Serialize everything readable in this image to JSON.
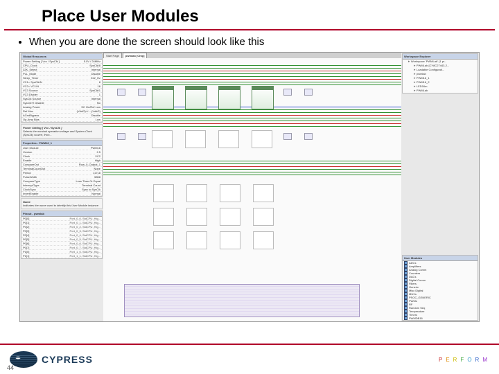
{
  "slide": {
    "title": "Place User Modules",
    "bullet": "When you are done the screen should look like this",
    "page_number": "44",
    "brand": "CYPRESS",
    "tagline": [
      "P",
      "E",
      "R",
      "F",
      "O",
      "R",
      "M"
    ]
  },
  "app": {
    "global_resources": {
      "title": "Global Resources",
      "rows": [
        [
          "Power Setting [ Vcc / SysClk ]",
          "5.0V / 24MHz"
        ],
        [
          "CPU_Clock",
          "SysClk/8"
        ],
        [
          "32K_Select",
          "Internal"
        ],
        [
          "PLL_Mode",
          "Disable"
        ],
        [
          "Sleep_Timer",
          "512_Hz"
        ],
        [
          "VC1= SysClk/N",
          "8"
        ],
        [
          "VC2= VC1/N",
          "16"
        ],
        [
          "VC3 Source",
          "SysClk/1"
        ],
        [
          "VC3 Divider",
          "1"
        ],
        [
          "SysClk Source",
          "Internal"
        ],
        [
          "SysClk*2 Disable",
          "No"
        ],
        [
          "Analog Power",
          "SC On/Ref Low"
        ],
        [
          "Ref Mux",
          "(Vdd/2)+/-...(Vdd/2)"
        ],
        [
          "AGndBypass",
          "Disable"
        ],
        [
          "Op-Amp Bias",
          "Low"
        ]
      ],
      "desc_title": "Power Setting [ Vcc / SysClk ]",
      "desc": "Selects the nominal operation voltage and System Clock (SysClk) source, from..."
    },
    "properties": {
      "title": "Properties - PWM16_1",
      "rows": [
        [
          "User Module",
          "PWM16"
        ],
        [
          "Version",
          "2.5"
        ],
        [
          "Clock",
          "VC2"
        ],
        [
          "Enable",
          "High"
        ],
        [
          "CompareOut",
          "Row_0_Output_1"
        ],
        [
          "TerminalCountOut",
          "None"
        ],
        [
          "Period",
          "11718"
        ],
        [
          "PulseWidth",
          "5858"
        ],
        [
          "CompareType",
          "Less Than Or Equal"
        ],
        [
          "InterruptType",
          "Terminal Count"
        ],
        [
          "ClockSync",
          "Sync to SysClk"
        ],
        [
          "InvertEnable",
          "Normal"
        ]
      ],
      "desc_title": "Name",
      "desc": "Indicates the name used to identify this User Module instance"
    },
    "pinout": {
      "title": "Pinout - pwmlab",
      "rows": [
        [
          "P0[0]",
          "Port_0_0, StdCPU, Hig..."
        ],
        [
          "P0[1]",
          "Port_0_1, StdCPU, Hig..."
        ],
        [
          "P0[2]",
          "Port_0_2, StdCPU, Hig..."
        ],
        [
          "P0[3]",
          "Port_0_3, StdCPU, Hig..."
        ],
        [
          "P0[4]",
          "Port_0_4, StdCPU, Hig..."
        ],
        [
          "P0[5]",
          "Port_0_5, StdCPU, Hig..."
        ],
        [
          "P0[6]",
          "Port_0_6, StdCPU, Hig..."
        ],
        [
          "P0[7]",
          "Port_0_7, StdCPU, Hig..."
        ],
        [
          "P1[0]",
          "Port_1_0, StdCPU, Hig..."
        ],
        [
          "P1[1]",
          "Port_1_1, StdCPU, Hig..."
        ]
      ]
    },
    "tabs": {
      "left": "Start Page",
      "right": "pwmlab [Chip]"
    },
    "workspace": {
      "title": "Workspace Explorer",
      "root": "Workspace 'PWMLab' (1 pr...",
      "items": [
        "PWMLab [CY8C27443-2...",
        "Loadable Configurati...",
        "pwmlab",
        "PWM16_1",
        "PWM16_2",
        "LED16m",
        "PWMLab"
      ]
    },
    "user_modules": {
      "title": "User Modules",
      "items": [
        "ADCs",
        "Amplifiers",
        "Analog Comm",
        "Counters",
        "DACs",
        "Digital Comm",
        "Filters",
        "Generic",
        "Misc Digital",
        "MUXs",
        "PSOC_GENERIC",
        "PWMs",
        "RF",
        "Random Seq",
        "Temperature",
        "Timers",
        "PWMDB16"
      ]
    }
  }
}
